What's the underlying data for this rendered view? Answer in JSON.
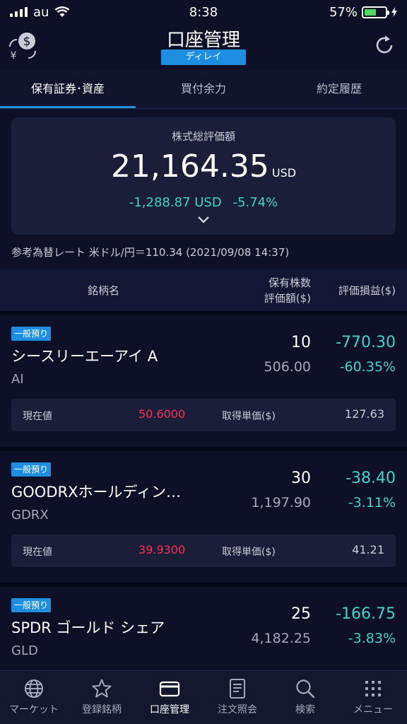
{
  "status": {
    "carrier": "au",
    "time": "8:38",
    "battery": "57%",
    "battery_level": 0.57
  },
  "header": {
    "title": "口座管理",
    "badge": "ディレイ"
  },
  "tabs": [
    "保有証券･資産",
    "買付余力",
    "約定履歴"
  ],
  "summary": {
    "label": "株式総評価額",
    "total": "21,164.35",
    "total_unit": "USD",
    "change_amount": "-1,288.87",
    "change_unit": "USD",
    "change_pct": "-5.74%"
  },
  "fx_rate": "参考為替レート 米ドル/円＝110.34 (2021/09/08 14:37)",
  "table_header": {
    "name": "銘柄名",
    "qty_line1": "保有株数",
    "qty_line2": "評価額($)",
    "pl": "評価損益($)"
  },
  "holdings": [
    {
      "tag": "一般預り",
      "name": "シースリーエーアイ A",
      "ticker": "AI",
      "qty": "10",
      "value": "506.00",
      "pl": "-770.30",
      "pl_pct": "-60.35%",
      "price_label": "現在値",
      "price": "50.6000",
      "cost_label": "取得単価($)",
      "cost": "127.63"
    },
    {
      "tag": "一般預り",
      "name": "GOODRXホールディン…",
      "ticker": "GDRX",
      "qty": "30",
      "value": "1,197.90",
      "pl": "-38.40",
      "pl_pct": "-3.11%",
      "price_label": "現在値",
      "price": "39.9300",
      "cost_label": "取得単価($)",
      "cost": "41.21"
    },
    {
      "tag": "一般預り",
      "name": "SPDR ゴールド シェア",
      "ticker": "GLD",
      "qty": "25",
      "value": "4,182.25",
      "pl": "-166.75",
      "pl_pct": "-3.83%"
    }
  ],
  "bottom_nav": [
    "マーケット",
    "登録銘柄",
    "口座管理",
    "注文照会",
    "検索",
    "メニュー"
  ],
  "colors": {
    "accent": "#1e8fe0",
    "positive_teal": "#3fd4c7",
    "price_red": "#ff2e4d",
    "background": "#0d1026"
  }
}
